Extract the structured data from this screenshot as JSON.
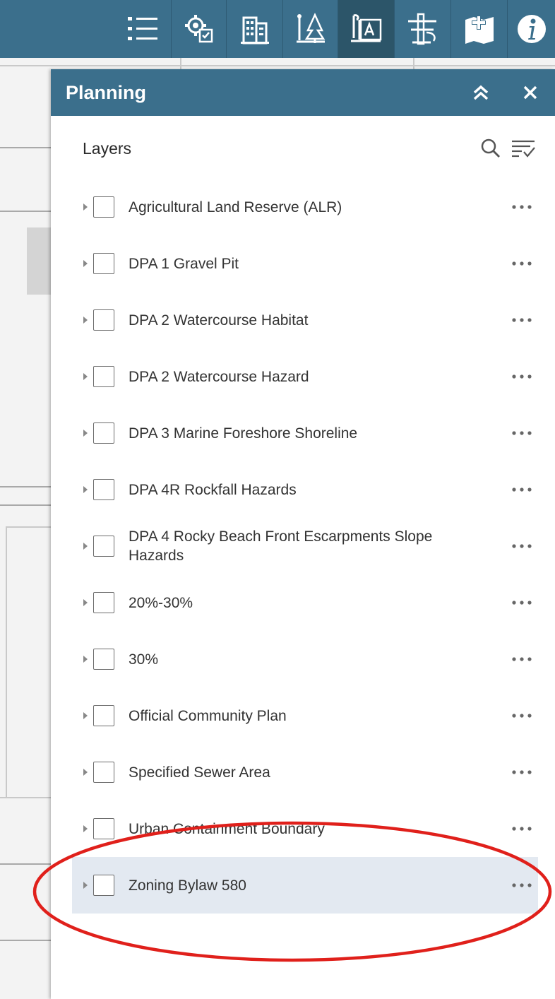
{
  "toolbar": {
    "tools": [
      {
        "name": "layer-list-icon",
        "active": false
      },
      {
        "name": "settings-icon",
        "active": false
      },
      {
        "name": "building-icon",
        "active": false
      },
      {
        "name": "parks-icon",
        "active": false
      },
      {
        "name": "planning-icon",
        "active": true
      },
      {
        "name": "utilities-icon",
        "active": false
      },
      {
        "name": "add-map-icon",
        "active": false
      },
      {
        "name": "info-icon",
        "active": false
      }
    ]
  },
  "panel": {
    "title": "Planning",
    "collapse_icon": "chevron-double-up-icon",
    "close_icon": "close-icon"
  },
  "layers": {
    "title": "Layers",
    "search_icon": "search-icon",
    "filter_icon": "filter-list-icon",
    "items": [
      {
        "label": "Agricultural Land Reserve (ALR)"
      },
      {
        "label": "DPA 1 Gravel Pit"
      },
      {
        "label": "DPA 2 Watercourse Habitat"
      },
      {
        "label": "DPA 2 Watercourse Hazard"
      },
      {
        "label": "DPA 3 Marine Foreshore Shoreline"
      },
      {
        "label": "DPA 4R Rockfall Hazards"
      },
      {
        "label": "DPA 4 Rocky Beach Front Escarpments Slope Hazards"
      },
      {
        "label": "20%-30%"
      },
      {
        "label": "30%"
      },
      {
        "label": "Official Community Plan"
      },
      {
        "label": "Specified Sewer Area"
      },
      {
        "label": "Urban Containment Boundary"
      },
      {
        "label": "Zoning Bylaw 580"
      }
    ],
    "highlighted_index": 12
  },
  "colors": {
    "header": "#3b6f8c",
    "active_tool": "#2c5569",
    "highlight_row": "#e3e9f1",
    "annotation": "#e0201b"
  }
}
